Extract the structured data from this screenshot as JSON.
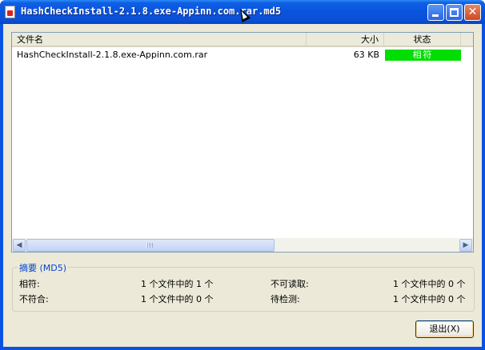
{
  "window": {
    "title": "HashCheckInstall-2.1.8.exe-Appinn.com.rar.md5",
    "title_color": "#0a54dc"
  },
  "list": {
    "columns": {
      "name": "文件名",
      "size": "大小",
      "status": "状态"
    },
    "rows": [
      {
        "name": "HashCheckInstall-2.1.8.exe-Appinn.com.rar",
        "size": "63 KB",
        "status": "相符",
        "status_color": "#00dd00"
      }
    ]
  },
  "summary": {
    "title": "摘要 (MD5)",
    "match_label": "相符:",
    "match_value": "1 个文件中的 1 个",
    "mismatch_label": "不符合:",
    "mismatch_value": "1 个文件中的 0 个",
    "unreadable_label": "不可读取:",
    "unreadable_value": "1 个文件中的 0 个",
    "pending_label": "待检测:",
    "pending_value": "1 个文件中的 0 个"
  },
  "buttons": {
    "exit": "退出(X)"
  },
  "icons": {
    "app": "hash-file-icon",
    "minimize": "minimize-icon",
    "maximize": "maximize-icon",
    "close": "close-icon",
    "scroll_left": "chevron-left-icon",
    "scroll_right": "chevron-right-icon",
    "cursor": "mouse-cursor-icon"
  }
}
